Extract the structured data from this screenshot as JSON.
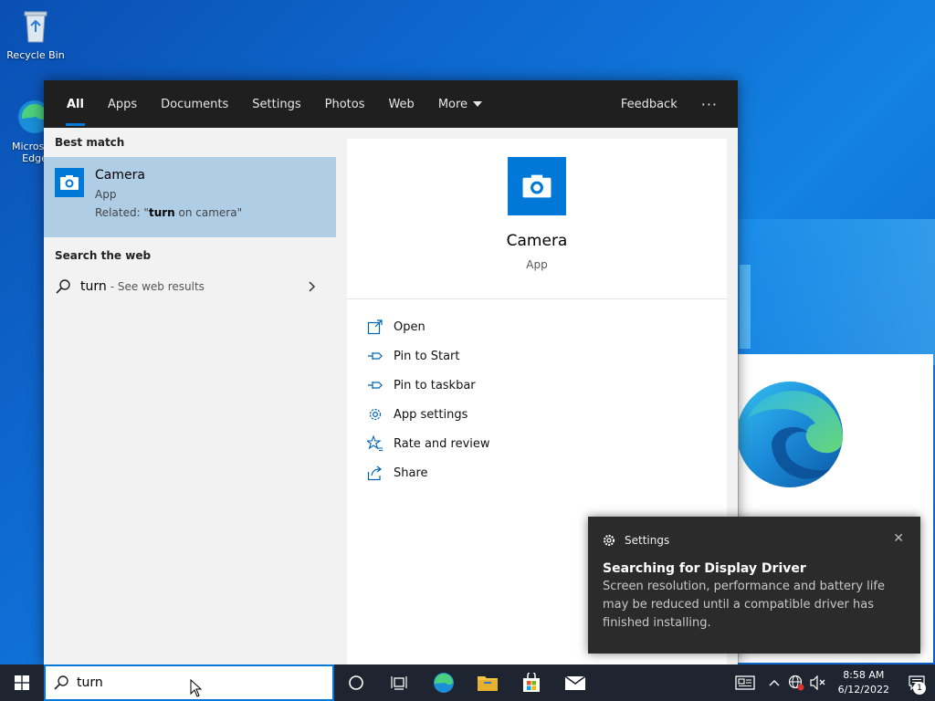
{
  "desktop": {
    "icons": [
      {
        "label": "Recycle Bin"
      },
      {
        "label": "Microsoft Edge"
      }
    ]
  },
  "search": {
    "tabs": [
      {
        "label": "All",
        "active": true
      },
      {
        "label": "Apps"
      },
      {
        "label": "Documents"
      },
      {
        "label": "Settings"
      },
      {
        "label": "Photos"
      },
      {
        "label": "Web"
      },
      {
        "label": "More"
      }
    ],
    "feedback": "Feedback",
    "more_options": "···",
    "best_match_header": "Best match",
    "best_match": {
      "title": "Camera",
      "type": "App",
      "related_prefix": "Related: \"",
      "related_bold": "turn",
      "related_suffix": " on camera\""
    },
    "web_header": "Search the web",
    "web_result": {
      "query": "turn",
      "hint": "- See web results"
    },
    "preview": {
      "title": "Camera",
      "type": "App"
    },
    "actions": [
      {
        "label": "Open",
        "icon": "open-icon"
      },
      {
        "label": "Pin to Start",
        "icon": "pin-icon"
      },
      {
        "label": "Pin to taskbar",
        "icon": "pin-icon"
      },
      {
        "label": "App settings",
        "icon": "gear-icon"
      },
      {
        "label": "Rate and review",
        "icon": "star-icon"
      },
      {
        "label": "Share",
        "icon": "share-icon"
      }
    ]
  },
  "toast": {
    "app": "Settings",
    "close": "✕",
    "title": "Searching for Display Driver",
    "body": "Screen resolution, performance and battery life may be reduced until a compatible driver has finished installing."
  },
  "taskbar": {
    "search_value": "turn ",
    "time": "8:58 AM",
    "date": "6/12/2022",
    "notification_count": "1"
  },
  "colors": {
    "accent": "#0078d7",
    "selection": "#b0cde6",
    "taskbar": "#1e2430",
    "toast": "#2b2b2b"
  }
}
